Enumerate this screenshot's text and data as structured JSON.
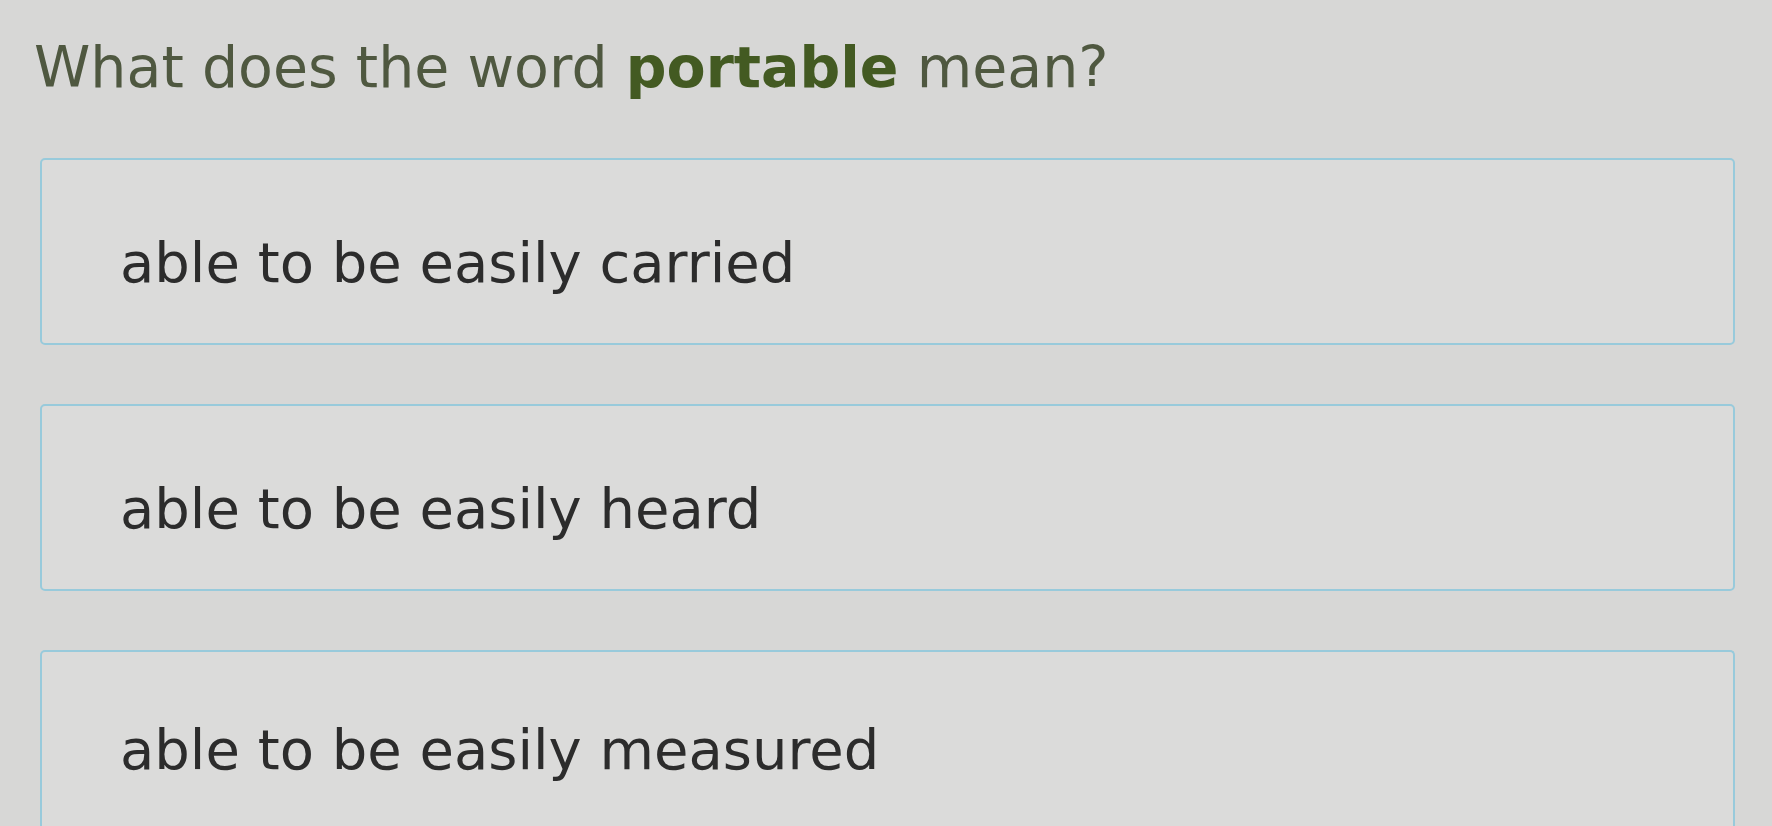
{
  "question": "What does the word **portable** mean?",
  "options": [
    {
      "text": "able to be easily carried",
      "selected": false
    },
    {
      "text": "able to be easily heard",
      "selected": false
    },
    {
      "text": "able to be easily measured",
      "selected": false
    }
  ]
}
